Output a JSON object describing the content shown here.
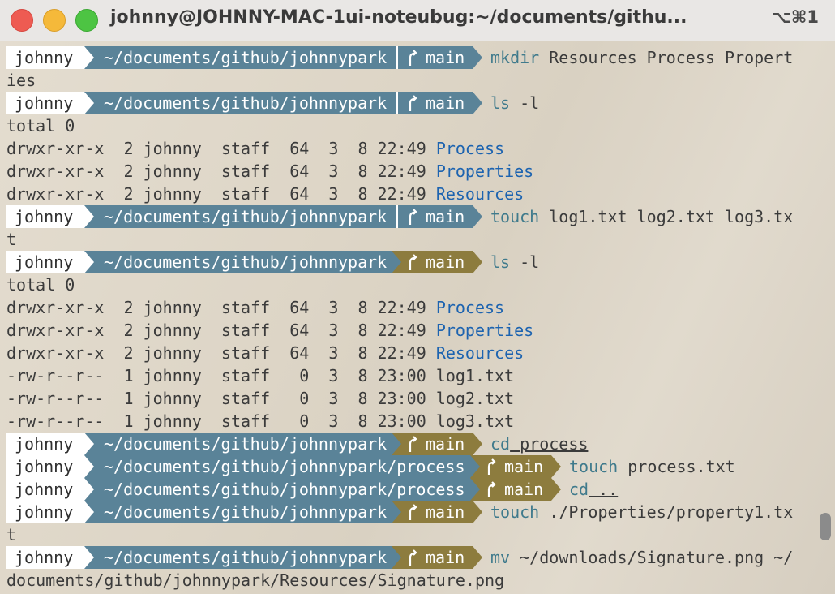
{
  "window": {
    "title": "johnny@JOHNNY-MAC-1ui-noteubug:~/documents/githu...",
    "shortcut": "⌥⌘1"
  },
  "prompt": {
    "user": "johnny",
    "path_root": "~/documents/github/johnnypark",
    "path_process": "~/documents/github/johnnypark/process",
    "branch": "main",
    "branch_icon": "git-branch-icon"
  },
  "colors": {
    "user_bg": "#ffffff",
    "path_bg": "#5a8398",
    "branch_clean_bg": "#5a8398",
    "branch_dirty_bg": "#8d7c3e",
    "directory": "#1c63b0",
    "command": "#3f7a8c"
  },
  "lines": [
    {
      "type": "prompt",
      "path": "root",
      "dirty": false,
      "cmd": "mkdir",
      "args": " Resources Process Propert"
    },
    {
      "type": "out",
      "text": "ies"
    },
    {
      "type": "prompt",
      "path": "root",
      "dirty": false,
      "cmd": "ls",
      "args": " -l"
    },
    {
      "type": "out",
      "text": "total 0"
    },
    {
      "type": "ls",
      "meta": "drwxr-xr-x  2 johnny  staff  64  3  8 22:49 ",
      "name": "Process",
      "dir": true
    },
    {
      "type": "ls",
      "meta": "drwxr-xr-x  2 johnny  staff  64  3  8 22:49 ",
      "name": "Properties",
      "dir": true
    },
    {
      "type": "ls",
      "meta": "drwxr-xr-x  2 johnny  staff  64  3  8 22:49 ",
      "name": "Resources",
      "dir": true
    },
    {
      "type": "prompt",
      "path": "root",
      "dirty": false,
      "cmd": "touch",
      "args": " log1.txt log2.txt log3.tx"
    },
    {
      "type": "out",
      "text": "t"
    },
    {
      "type": "prompt",
      "path": "root",
      "dirty": true,
      "cmd": "ls",
      "args": " -l"
    },
    {
      "type": "out",
      "text": "total 0"
    },
    {
      "type": "ls",
      "meta": "drwxr-xr-x  2 johnny  staff  64  3  8 22:49 ",
      "name": "Process",
      "dir": true
    },
    {
      "type": "ls",
      "meta": "drwxr-xr-x  2 johnny  staff  64  3  8 22:49 ",
      "name": "Properties",
      "dir": true
    },
    {
      "type": "ls",
      "meta": "drwxr-xr-x  2 johnny  staff  64  3  8 22:49 ",
      "name": "Resources",
      "dir": true
    },
    {
      "type": "ls",
      "meta": "-rw-r--r--  1 johnny  staff   0  3  8 23:00 ",
      "name": "log1.txt",
      "dir": false
    },
    {
      "type": "ls",
      "meta": "-rw-r--r--  1 johnny  staff   0  3  8 23:00 ",
      "name": "log2.txt",
      "dir": false
    },
    {
      "type": "ls",
      "meta": "-rw-r--r--  1 johnny  staff   0  3  8 23:00 ",
      "name": "log3.txt",
      "dir": false
    },
    {
      "type": "prompt",
      "path": "root",
      "dirty": true,
      "cmd": "cd",
      "args": " process",
      "ul": true
    },
    {
      "type": "prompt",
      "path": "process",
      "dirty": true,
      "cmd": "touch",
      "args": " process.txt"
    },
    {
      "type": "prompt",
      "path": "process",
      "dirty": true,
      "cmd": "cd",
      "args": " ..",
      "ul": true
    },
    {
      "type": "prompt",
      "path": "root",
      "dirty": true,
      "cmd": "touch",
      "args": " ./Properties/property1.tx"
    },
    {
      "type": "out",
      "text": "t"
    },
    {
      "type": "prompt",
      "path": "root",
      "dirty": true,
      "cmd": "mv",
      "args": " ~/downloads/Signature.png ~/"
    },
    {
      "type": "out",
      "text": "documents/github/johnnypark/Resources/Signature.png"
    }
  ]
}
